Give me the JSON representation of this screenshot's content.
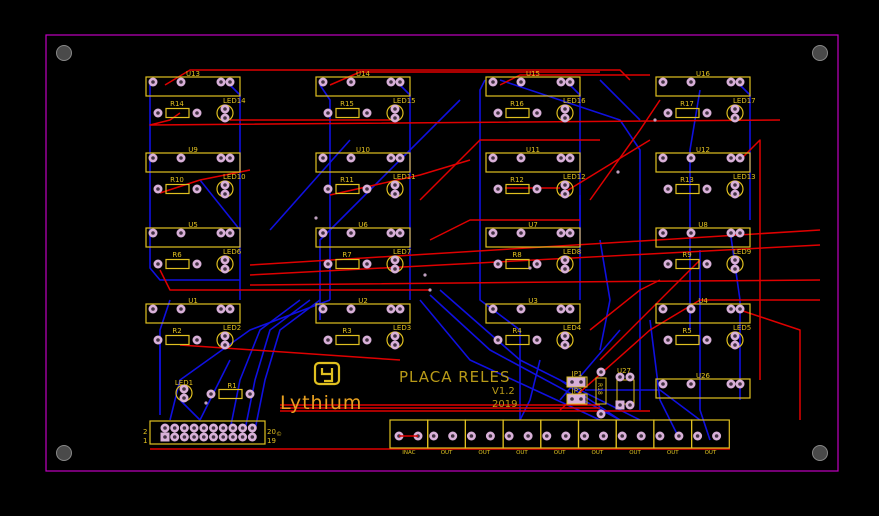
{
  "board": {
    "title": "PLACA RELES",
    "version": "V1.2",
    "year": "2019",
    "brand": "Lythium",
    "colors": {
      "outline": "#c000c0",
      "silkscreen": "#e0c020",
      "top_copper": "#e00000",
      "bottom_copper": "#1010e0",
      "pad": "#d8b0d8"
    }
  },
  "relay_grid": [
    [
      {
        "u": "U13",
        "r": "R14",
        "led": "LED14"
      },
      {
        "u": "U14",
        "r": "R15",
        "led": "LED15"
      },
      {
        "u": "U15",
        "r": "R16",
        "led": "LED16"
      },
      {
        "u": "U16",
        "r": "R17",
        "led": "LED17"
      }
    ],
    [
      {
        "u": "U9",
        "r": "R10",
        "led": "LED10"
      },
      {
        "u": "U10",
        "r": "R11",
        "led": "LED11"
      },
      {
        "u": "U11",
        "r": "R12",
        "led": "LED12"
      },
      {
        "u": "U12",
        "r": "R13",
        "led": "LED13"
      }
    ],
    [
      {
        "u": "U5",
        "r": "R6",
        "led": "LED6"
      },
      {
        "u": "U6",
        "r": "R7",
        "led": "LED7"
      },
      {
        "u": "U7",
        "r": "R8",
        "led": "LED8"
      },
      {
        "u": "U8",
        "r": "R9",
        "led": "LED9"
      }
    ],
    [
      {
        "u": "U1",
        "r": "R2",
        "led": "LED2"
      },
      {
        "u": "U2",
        "r": "R3",
        "led": "LED3"
      },
      {
        "u": "U3",
        "r": "R4",
        "led": "LED4"
      },
      {
        "u": "U4",
        "r": "R5",
        "led": "LED5"
      }
    ]
  ],
  "extra": {
    "u26": "U26",
    "u27": "U27",
    "led1": "LED1",
    "r1": "R1",
    "r18": "R18",
    "jp1": "JP1",
    "jp2": "JP2"
  },
  "header": {
    "pin2": "2",
    "pin1": "1",
    "pin20": "20",
    "pin19": "19",
    "mark": "©"
  },
  "terminals": [
    "INAC",
    "OUT",
    "OUT",
    "OUT",
    "OUT",
    "OUT",
    "OUT",
    "OUT",
    "OUT"
  ]
}
